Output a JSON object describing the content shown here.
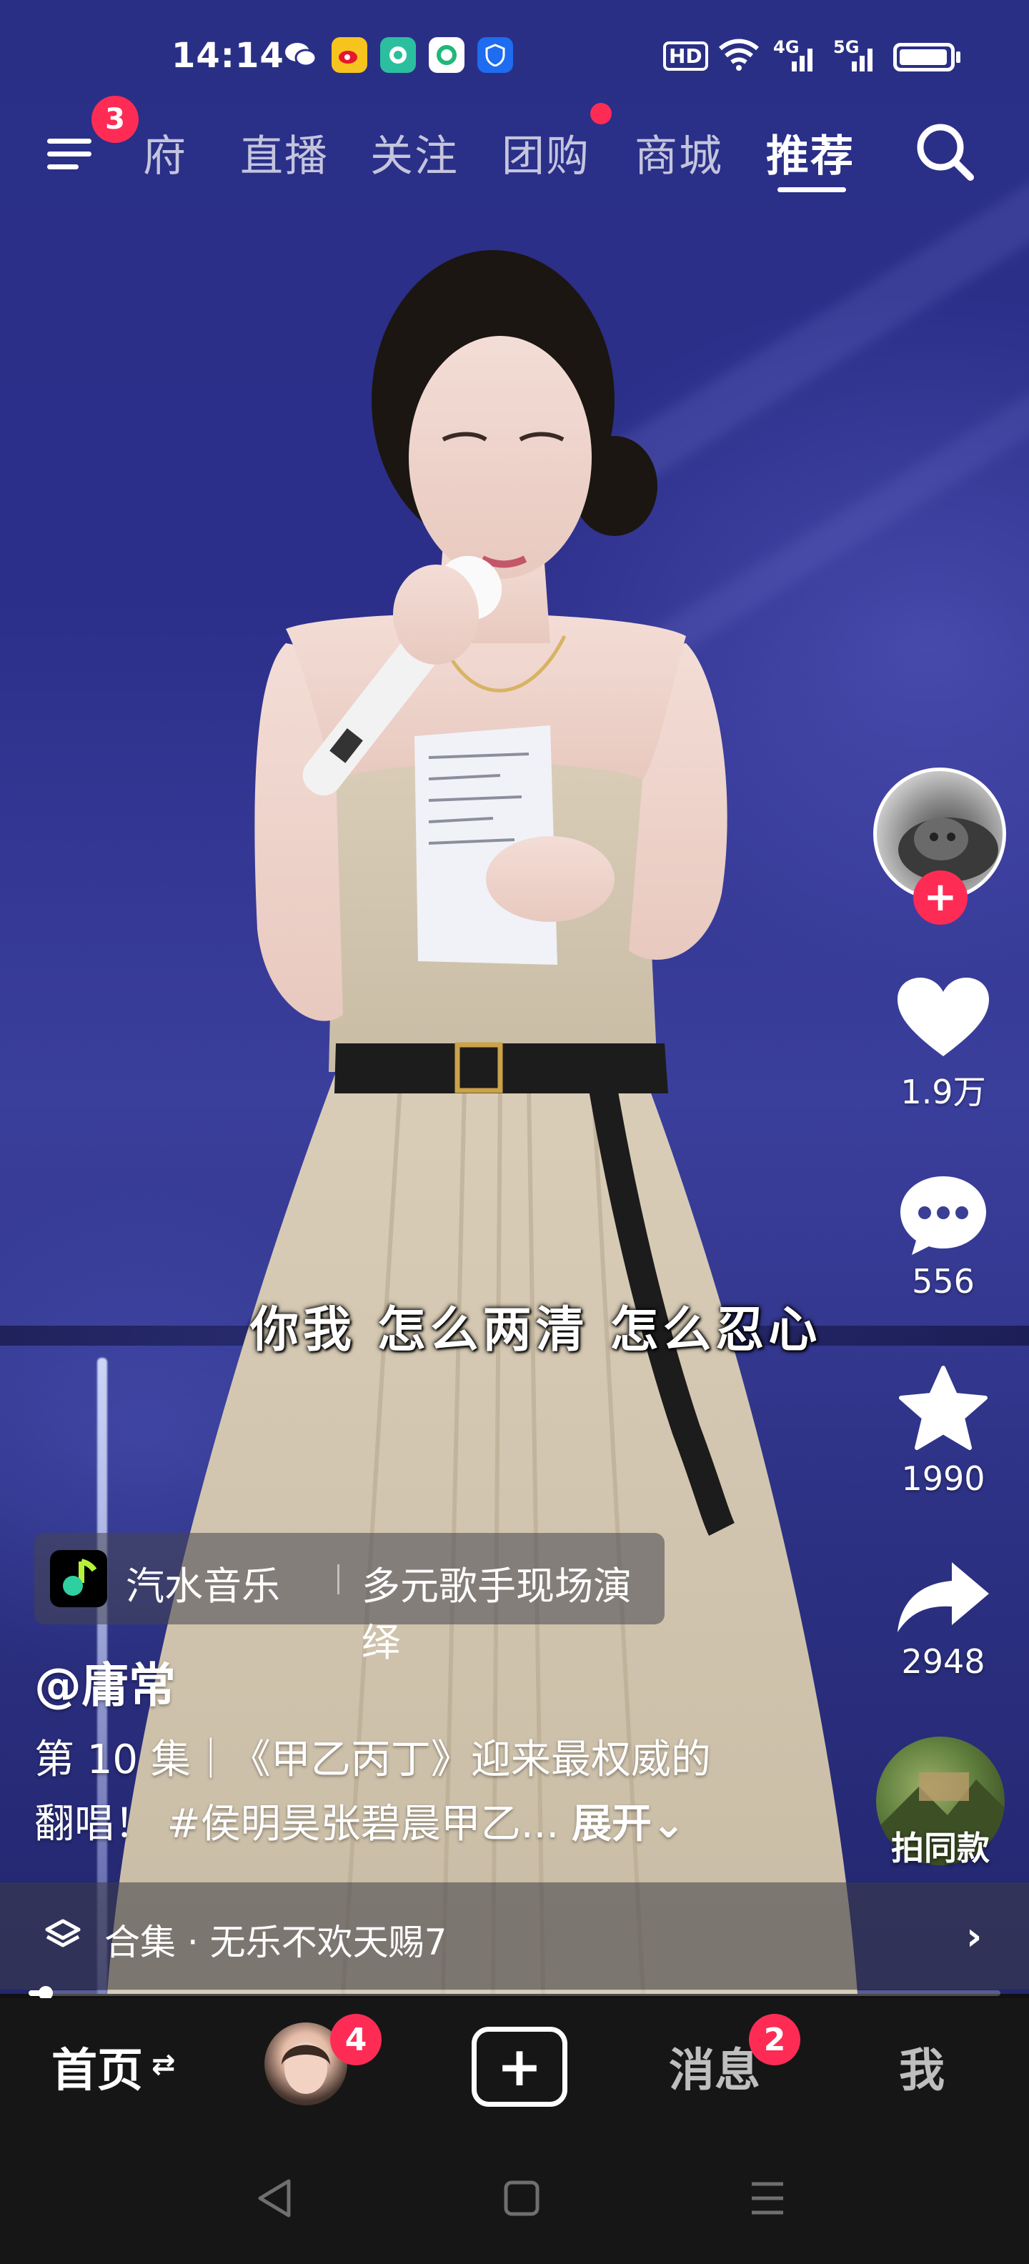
{
  "status_bar": {
    "time": "14:14",
    "network_hd": "HD",
    "network_4g": "4G",
    "network_5g": "5G",
    "app_icons": [
      "wechat-icon",
      "weibo-icon",
      "messaging-app-icon",
      "app-icon",
      "security-shield-icon"
    ]
  },
  "top_nav": {
    "menu_badge": "3",
    "tabs": [
      "府",
      "直播",
      "关注",
      "团购",
      "商城",
      "推荐"
    ],
    "active_tab": "推荐",
    "tuangou_has_dot": true
  },
  "video": {
    "subtitle": "你我 怎么两清 怎么忍心"
  },
  "actions": {
    "likes": "1.9万",
    "comments": "556",
    "favorites": "1990",
    "shares": "2948",
    "same_style": "拍同款"
  },
  "music": {
    "app": "汽水音乐",
    "desc": "多元歌手现场演绎"
  },
  "post": {
    "author": "@庸常",
    "desc_line1": "第 10 集｜《甲乙丙丁》迎来最权威的",
    "desc_line2": "翻唱！ #侯明昊张碧晨甲乙...",
    "expand": "展开⌄"
  },
  "collection": {
    "text": "合集 · 无乐不欢天赐7",
    "chevron": "›"
  },
  "progress": {
    "fraction": 0.018
  },
  "tab_bar": {
    "home": "首页",
    "home_switch": "⇄",
    "friends_badge": "4",
    "add": "+",
    "messages": "消息",
    "messages_badge": "2",
    "me": "我"
  },
  "colors": {
    "accent": "#fe2c55",
    "background_blue": "#2c2f8a"
  }
}
